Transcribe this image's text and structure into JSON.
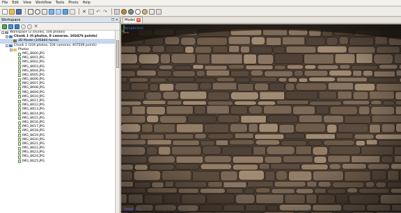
{
  "menu": [
    "File",
    "Edit",
    "View",
    "Workflow",
    "Tools",
    "Photo",
    "Help"
  ],
  "workspace": {
    "title": "Workspace",
    "controls": "❒ ✕",
    "root": "Workspace (2 chunks, 104 photos)",
    "chunk1": "Chunk 1 (0 photos, 0 cameras, 103476 points)",
    "model": "3D Model (195840 faces)",
    "chunk2": "Chunk 2 (104 photos, 104 cameras, 407509 points)",
    "photos_folder": "Photos",
    "photos": [
      "IMG_8600.JPG",
      "IMG_8601.JPG",
      "IMG_8602.JPG",
      "IMG_8603.JPG",
      "IMG_8604.JPG",
      "IMG_8605.JPG",
      "IMG_8606.JPG",
      "IMG_8607.JPG",
      "IMG_8608.JPG",
      "IMG_8609.JPG",
      "IMG_8610.JPG",
      "IMG_8611.JPG",
      "IMG_8612.JPG",
      "IMG_8613.JPG",
      "IMG_8614.JPG",
      "IMG_8615.JPG",
      "IMG_8616.JPG",
      "IMG_8617.JPG",
      "IMG_8618.JPG",
      "IMG_8619.JPG",
      "IMG_8620.JPG",
      "IMG_8621.JPG",
      "IMG_8622.JPG",
      "IMG_8623.JPG",
      "IMG_8624.JPG",
      "IMG_8625.JPG"
    ]
  },
  "model_tab": {
    "label": "Model"
  },
  "viewport": {
    "caption": "Perspective",
    "footer": "Press: [C] ..."
  },
  "colors": {
    "accent": "#3f7fc4",
    "selection": "#c6d7ef",
    "tab_close": "#e0543b"
  }
}
